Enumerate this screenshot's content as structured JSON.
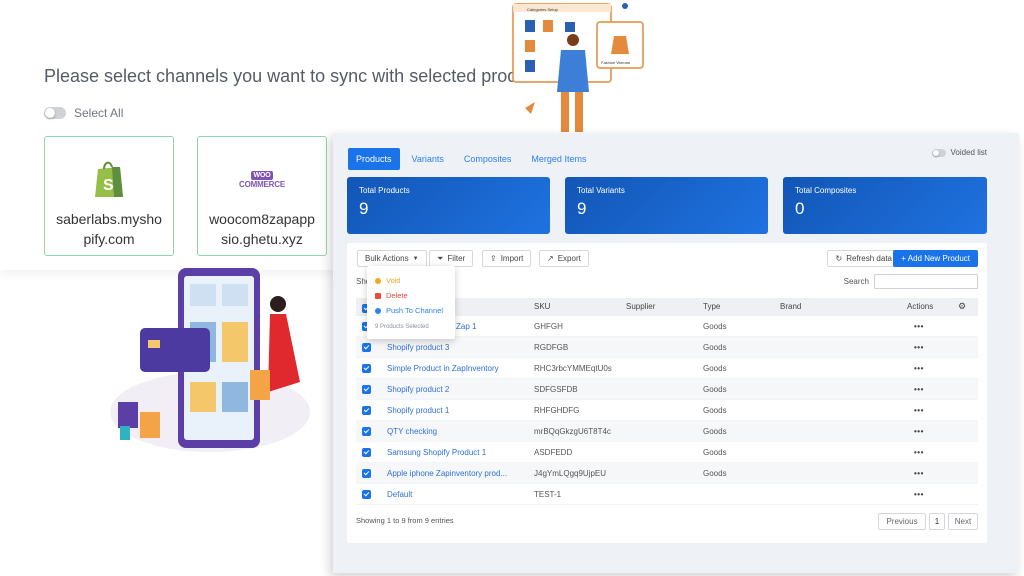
{
  "sync": {
    "title": "Please select channels you want to sync with selected produ",
    "select_all": "Select All",
    "channels": [
      {
        "name": "saberlabs.myshopify.com",
        "logo": "shopify-icon"
      },
      {
        "name": "woocom8zapappsio.ghetu.xyz",
        "logo": "woocommerce-icon",
        "logo_text_1": "WOO",
        "logo_text_2": "COMMERCE"
      }
    ]
  },
  "illustration_top": {
    "window_title": "Categories Setup",
    "badge_label": "Fashion Woman"
  },
  "app": {
    "tabs": [
      "Products",
      "Variants",
      "Composites",
      "Merged Items"
    ],
    "voided_list": "Voided list",
    "stats": [
      {
        "label": "Total Products",
        "value": "9"
      },
      {
        "label": "Total Variants",
        "value": "9"
      },
      {
        "label": "Total Composites",
        "value": "0"
      }
    ],
    "toolbar": {
      "bulk_actions": "Bulk Actions",
      "filter": "Filter",
      "import": "Import",
      "export": "Export",
      "refresh": "Refresh data",
      "add_new": "+ Add New Product",
      "search_label": "Search",
      "show_partial": "Sho"
    },
    "bulk_menu": {
      "items": [
        "Void",
        "Delete",
        "Push To Channel"
      ],
      "note": "9 Products Selected"
    },
    "columns": [
      "SKU",
      "Supplier",
      "Type",
      "Brand",
      "Actions"
    ],
    "rows": [
      {
        "name": "Zap 1",
        "sku": "GHFGH",
        "type": "Goods"
      },
      {
        "name": "Shopify product 3",
        "sku": "RGDFGB",
        "type": "Goods"
      },
      {
        "name": "Simple Product in ZapInventory",
        "sku": "RHC3rbcYMMEqtU0s",
        "type": "Goods"
      },
      {
        "name": "Shopify product 2",
        "sku": "SDFGSFDB",
        "type": "Goods"
      },
      {
        "name": "Shopify product 1",
        "sku": "RHFGHDFG",
        "type": "Goods"
      },
      {
        "name": "QTY checking",
        "sku": "mrBQqGkzgU6T8T4c",
        "type": "Goods"
      },
      {
        "name": "Samsung Shopify Product 1",
        "sku": "ASDFEDD",
        "type": "Goods"
      },
      {
        "name": "Apple iphone Zapinventory prod...",
        "sku": "J4gYmLQgq9UjpEU",
        "type": "Goods"
      },
      {
        "name": "Default",
        "sku": "TEST-1",
        "type": ""
      }
    ],
    "row_action": "•••",
    "footer": "Showing 1 to 9 from 9 entries",
    "pagination": {
      "previous": "Previous",
      "page": "1",
      "next": "Next"
    }
  },
  "colors": {
    "accent": "#1a73e8",
    "card_border": "#8fd6b0",
    "void": "#f5a623",
    "delete": "#e74c3c",
    "push": "#2f80ed"
  }
}
